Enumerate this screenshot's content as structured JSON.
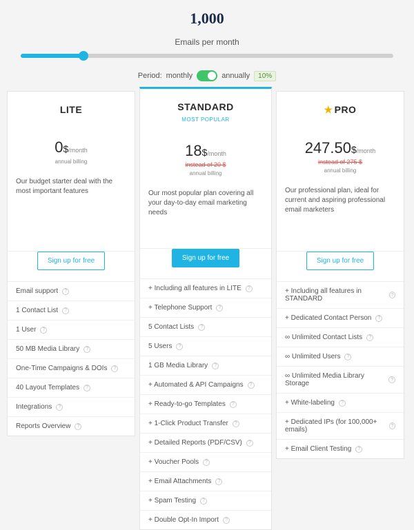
{
  "header": {
    "value": "1,000",
    "label": "Emails per month"
  },
  "period": {
    "prefix": "Period:",
    "monthly": "monthly",
    "annually": "annually",
    "discount": "10%"
  },
  "plans": {
    "lite": {
      "name": "LITE",
      "price": "0",
      "currency": "$",
      "per": "/month",
      "billing": "annual billing",
      "desc": "Our budget starter deal with the most important features",
      "cta": "Sign up for free",
      "features": [
        "Email support",
        "1 Contact List",
        "1 User",
        "50 MB Media Library",
        "One-Time Campaigns & DOIs",
        "40 Layout Templates",
        "Integrations",
        "Reports Overview"
      ]
    },
    "standard": {
      "name": "STANDARD",
      "popular": "MOST POPULAR",
      "price": "18",
      "currency": "$",
      "per": "/month",
      "instead": "instead of 20 $",
      "billing": "annual billing",
      "desc": "Our most popular plan covering all your day-to-day email marketing needs",
      "cta": "Sign up for free",
      "features": [
        "+ Including all features in LITE",
        "+ Telephone Support",
        "5 Contact Lists",
        "5 Users",
        "1 GB Media Library",
        "+ Automated & API Campaigns",
        "+ Ready-to-go Templates",
        "+ 1-Click Product Transfer",
        "+ Detailed Reports (PDF/CSV)",
        "+ Voucher Pools",
        "+ Email Attachments",
        "+ Spam Testing",
        "+ Double Opt-In Import"
      ]
    },
    "pro": {
      "name": "PRO",
      "price": "247.50",
      "currency": "$",
      "per": "/month",
      "instead": "instead of 275 $",
      "billing": "annual billing",
      "desc": "Our professional plan, ideal for current and aspiring professional email marketers",
      "cta": "Sign up for free",
      "features": [
        "+ Including all features in STANDARD",
        "+ Dedicated Contact Person",
        "∞ Unlimited Contact Lists",
        "∞ Unlimited Users",
        "∞ Unlimited Media Library Storage",
        "+ White-labeling",
        "+ Dedicated IPs (for 100,000+ emails)",
        "+ Email Client Testing"
      ]
    }
  }
}
